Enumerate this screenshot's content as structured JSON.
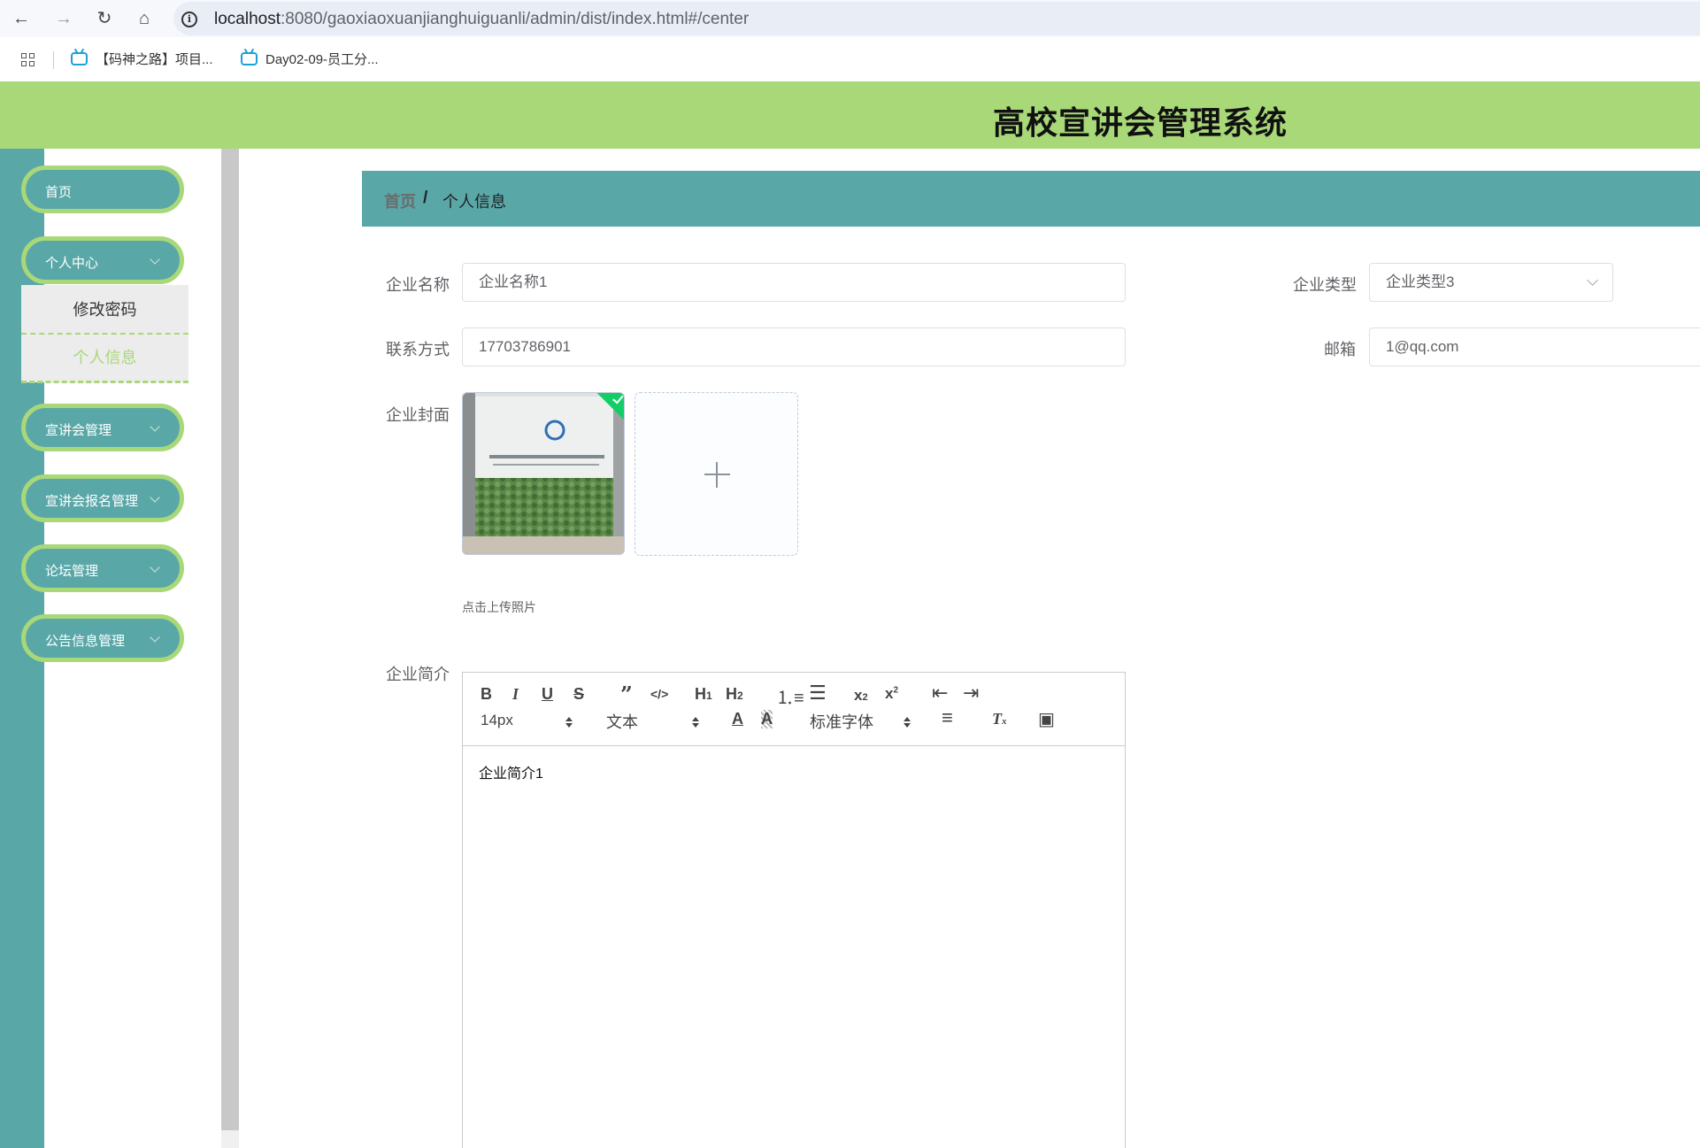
{
  "browser": {
    "url_host": "localhost",
    "url_rest": ":8080/gaoxiaoxuanjianghuiguanli/admin/dist/index.html#/center",
    "bookmarks": [
      {
        "label": "【码神之路】项目..."
      },
      {
        "label": "Day02-09-员工分..."
      }
    ]
  },
  "header": {
    "title": "高校宣讲会管理系统"
  },
  "sidebar": {
    "items": [
      {
        "label": "首页"
      },
      {
        "label": "个人中心"
      },
      {
        "label": "宣讲会管理"
      },
      {
        "label": "宣讲会报名管理"
      },
      {
        "label": "论坛管理"
      },
      {
        "label": "公告信息管理"
      }
    ],
    "submenu": [
      {
        "label": "修改密码"
      },
      {
        "label": "个人信息"
      }
    ]
  },
  "breadcrumb": {
    "home": "首页",
    "separator": "/",
    "current": "个人信息"
  },
  "form": {
    "company_name": {
      "label": "企业名称",
      "value": "企业名称1"
    },
    "company_type": {
      "label": "企业类型",
      "value": "企业类型3"
    },
    "contact": {
      "label": "联系方式",
      "value": "17703786901"
    },
    "email": {
      "label": "邮箱",
      "value": "1@qq.com"
    },
    "cover": {
      "label": "企业封面",
      "tip": "点击上传照片"
    },
    "intro": {
      "label": "企业简介",
      "content": "企业简介1"
    }
  },
  "editor": {
    "font_size": "14px",
    "header_picker": "文本",
    "font_family": "标准字体"
  },
  "colors": {
    "header_green": "#a8d878",
    "teal": "#5aa7a8",
    "success": "#13ce66"
  }
}
